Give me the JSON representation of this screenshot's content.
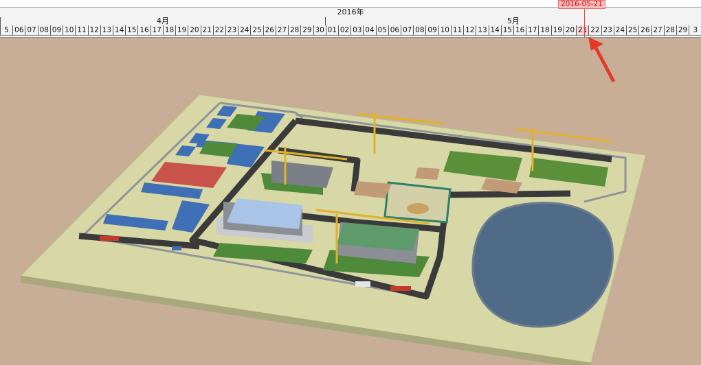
{
  "timeline": {
    "year_label": "2016年",
    "months": [
      {
        "label": "4月"
      },
      {
        "label": "5月"
      }
    ],
    "days": [
      "5",
      "06",
      "07",
      "08",
      "09",
      "10",
      "11",
      "12",
      "13",
      "14",
      "15",
      "16",
      "17",
      "18",
      "19",
      "20",
      "21",
      "22",
      "23",
      "24",
      "25",
      "26",
      "27",
      "28",
      "29",
      "30",
      "01",
      "02",
      "03",
      "04",
      "05",
      "06",
      "07",
      "08",
      "09",
      "10",
      "11",
      "12",
      "13",
      "14",
      "15",
      "16",
      "17",
      "18",
      "19",
      "20",
      "21",
      "22",
      "23",
      "24",
      "25",
      "26",
      "27",
      "28",
      "29",
      "3"
    ],
    "current_date": "2016-05-21",
    "marker_color": "#e84a4a"
  },
  "scene": {
    "description_icon": "construction-site-3d-model",
    "ground_color": "#d8d8a6",
    "background_color": "#c8ae96",
    "pond_color": "#4f6b88"
  }
}
